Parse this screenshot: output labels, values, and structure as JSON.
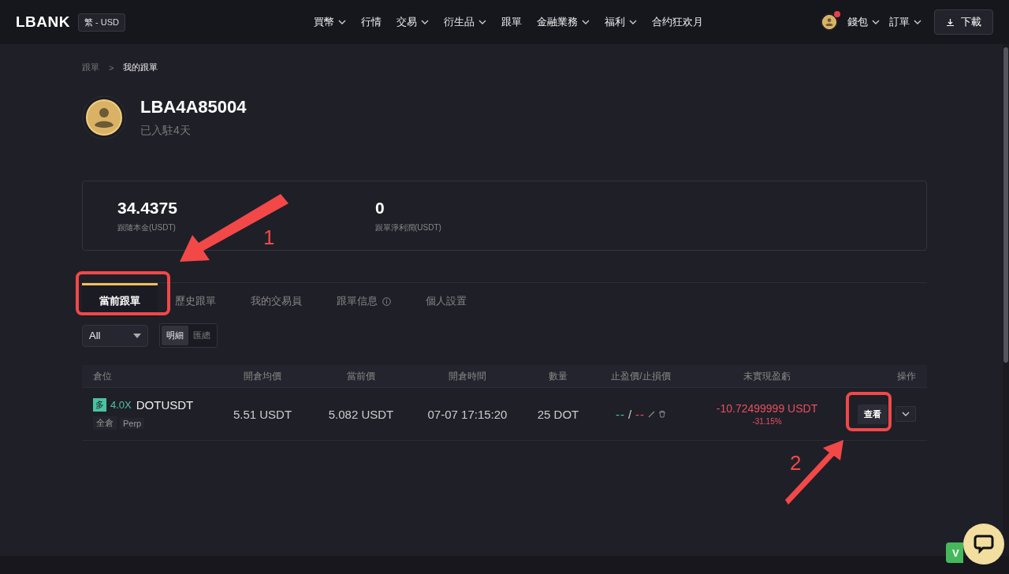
{
  "header": {
    "logo": "LBANK",
    "locale": "繁 - USD",
    "notification": true,
    "nav": [
      {
        "label": "買幣",
        "dropdown": true
      },
      {
        "label": "行情",
        "dropdown": false
      },
      {
        "label": "交易",
        "dropdown": true
      },
      {
        "label": "衍生品",
        "dropdown": true
      },
      {
        "label": "跟單",
        "dropdown": false
      },
      {
        "label": "金融業務",
        "dropdown": true
      },
      {
        "label": "福利",
        "dropdown": true
      },
      {
        "label": "合约狂欢月",
        "dropdown": false
      }
    ],
    "wallet": "錢包",
    "orders": "訂單",
    "download": "下載"
  },
  "breadcrumb": {
    "items": [
      "跟單",
      "我的跟單"
    ],
    "separator": ">"
  },
  "profile": {
    "name": "LBA4A85004",
    "joined": "已入駐4天"
  },
  "stats": [
    {
      "value": "34.4375",
      "label": "跟隨本金(USDT)"
    },
    {
      "value": "0",
      "label": "跟單淨利潤(USDT)"
    }
  ],
  "tabs": [
    {
      "label": "當前跟單",
      "selected": true,
      "info": false
    },
    {
      "label": "歷史跟單",
      "selected": false,
      "info": false
    },
    {
      "label": "我的交易員",
      "selected": false,
      "info": false
    },
    {
      "label": "跟單信息",
      "selected": false,
      "info": true
    },
    {
      "label": "個人設置",
      "selected": false,
      "info": false
    }
  ],
  "filter": {
    "value": "All"
  },
  "view_toggle": [
    {
      "label": "明細",
      "selected": true
    },
    {
      "label": "匯總",
      "selected": false
    }
  ],
  "table": {
    "columns": [
      "倉位",
      "開倉均價",
      "當前價",
      "開倉時間",
      "數量",
      "止盈價/止損價",
      "未實現盈虧",
      "操作"
    ],
    "rows": [
      {
        "side": "多",
        "leverage": "4.0X",
        "symbol": "DOTUSDT",
        "margin_mode": "全倉",
        "contract": "Perp",
        "entry_price": "5.51 USDT",
        "current_price": "5.082 USDT",
        "open_time": "07-07 17:15:20",
        "quantity": "25 DOT",
        "take_profit": "--",
        "tp_sl_separator": "/",
        "stop_loss": "--",
        "pnl": "-10.72499999 USDT",
        "pnl_pct": "-31.15%",
        "action": "查看"
      }
    ]
  },
  "feedback_button": "V",
  "annotations": [
    {
      "label": "1"
    },
    {
      "label": "2"
    }
  ]
}
